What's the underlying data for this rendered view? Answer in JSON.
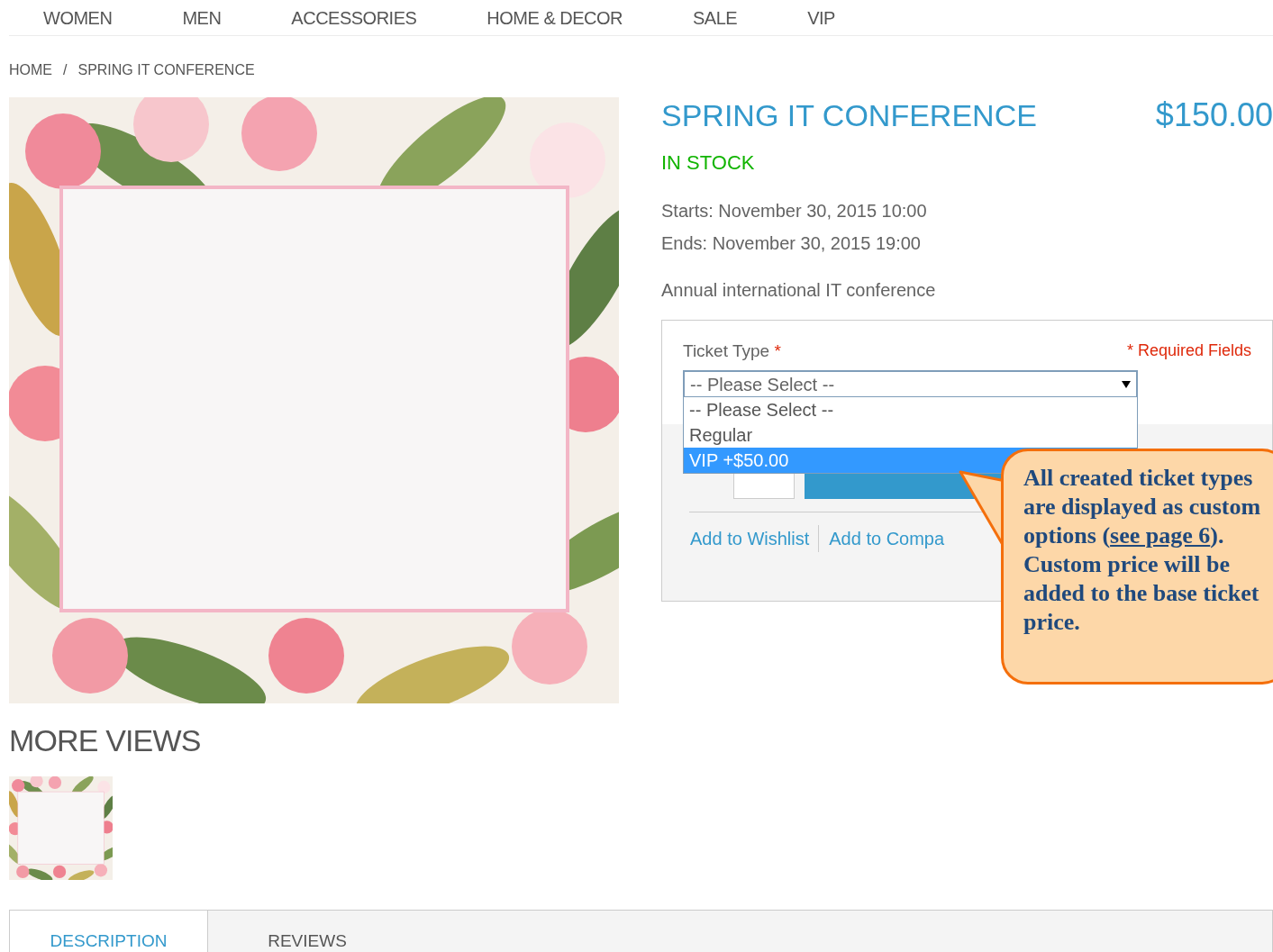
{
  "nav": [
    {
      "label": "WOMEN"
    },
    {
      "label": "MEN"
    },
    {
      "label": "ACCESSORIES"
    },
    {
      "label": "HOME & DECOR"
    },
    {
      "label": "SALE"
    },
    {
      "label": "VIP"
    }
  ],
  "breadcrumb": {
    "items": [
      "HOME",
      "SPRING IT CONFERENCE"
    ],
    "separator": "/"
  },
  "product": {
    "title": "SPRING IT CONFERENCE",
    "price": "$150.00",
    "availability": "IN STOCK",
    "starts": "Starts: November 30, 2015 10:00",
    "ends": "Ends: November 30, 2015 19:00",
    "description": "Annual international IT conference"
  },
  "options": {
    "label": "Ticket Type",
    "required_mark": "*",
    "required_note": "* Required Fields",
    "select_value": "-- Please Select --",
    "dropdown": [
      {
        "label": "-- Please Select --",
        "selected": false
      },
      {
        "label": "Regular",
        "selected": false
      },
      {
        "label": "VIP +$50.00",
        "selected": true
      }
    ],
    "links": [
      "Add to Wishlist",
      "Add to Compa"
    ]
  },
  "more_views": {
    "title": "MORE VIEWS"
  },
  "tabs": [
    {
      "label": "DESCRIPTION",
      "selected": true
    },
    {
      "label": "REVIEWS",
      "selected": false
    }
  ],
  "callout": {
    "text_before": "All created ticket types are displayed as custom options (",
    "link": "see page 6",
    "text_after": "). Custom price will be added to the base ticket price."
  }
}
